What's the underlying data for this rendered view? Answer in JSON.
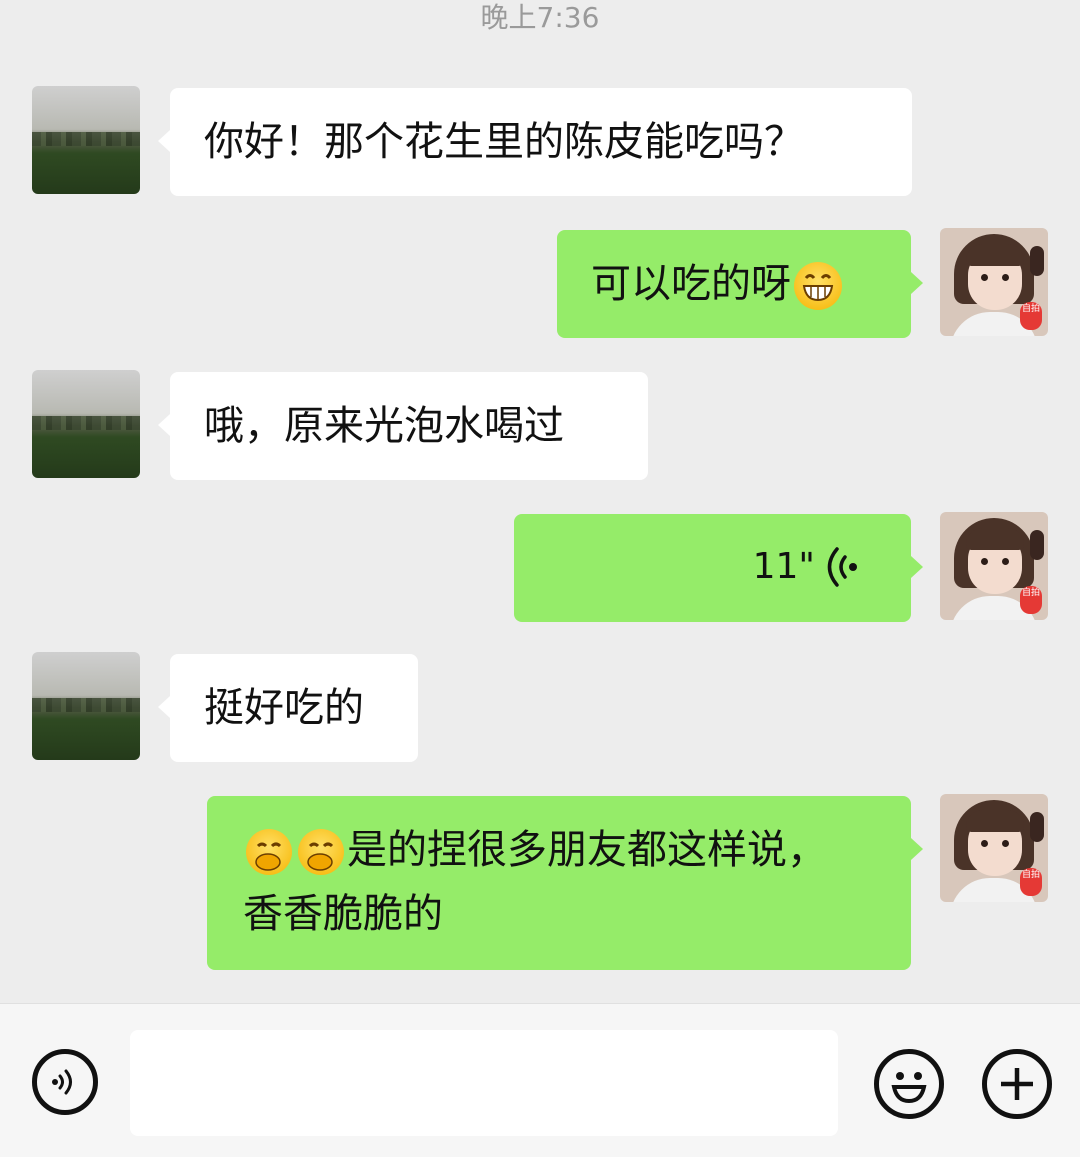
{
  "chat": {
    "timestamp": "晚上7:36",
    "messages": [
      {
        "sender": "other",
        "text": "你好！那个花生里的陈皮能吃吗？"
      },
      {
        "sender": "me",
        "text": "可以吃的呀",
        "emoji": "grinning-face-emoji"
      },
      {
        "sender": "other",
        "text": "哦，原来光泡水喝过"
      },
      {
        "sender": "me",
        "type": "voice",
        "duration": "11\"",
        "icon": "voice-wave-icon"
      },
      {
        "sender": "other",
        "text": "挺好吃的"
      },
      {
        "sender": "me",
        "emoji": "hand-over-mouth-emoji",
        "line1": "是的捏很多朋友都这样说，",
        "line2": "香香脆脆的"
      }
    ],
    "avatar_badge": "自拍"
  },
  "input_bar": {
    "voice_icon": "voice-mode-icon",
    "input_value": "",
    "emoji_icon": "emoji-icon",
    "plus_icon": "plus-icon"
  },
  "colors": {
    "background": "#ededed",
    "my_bubble": "#95ec69",
    "other_bubble": "#ffffff",
    "timestamp": "#9a9a9a"
  }
}
